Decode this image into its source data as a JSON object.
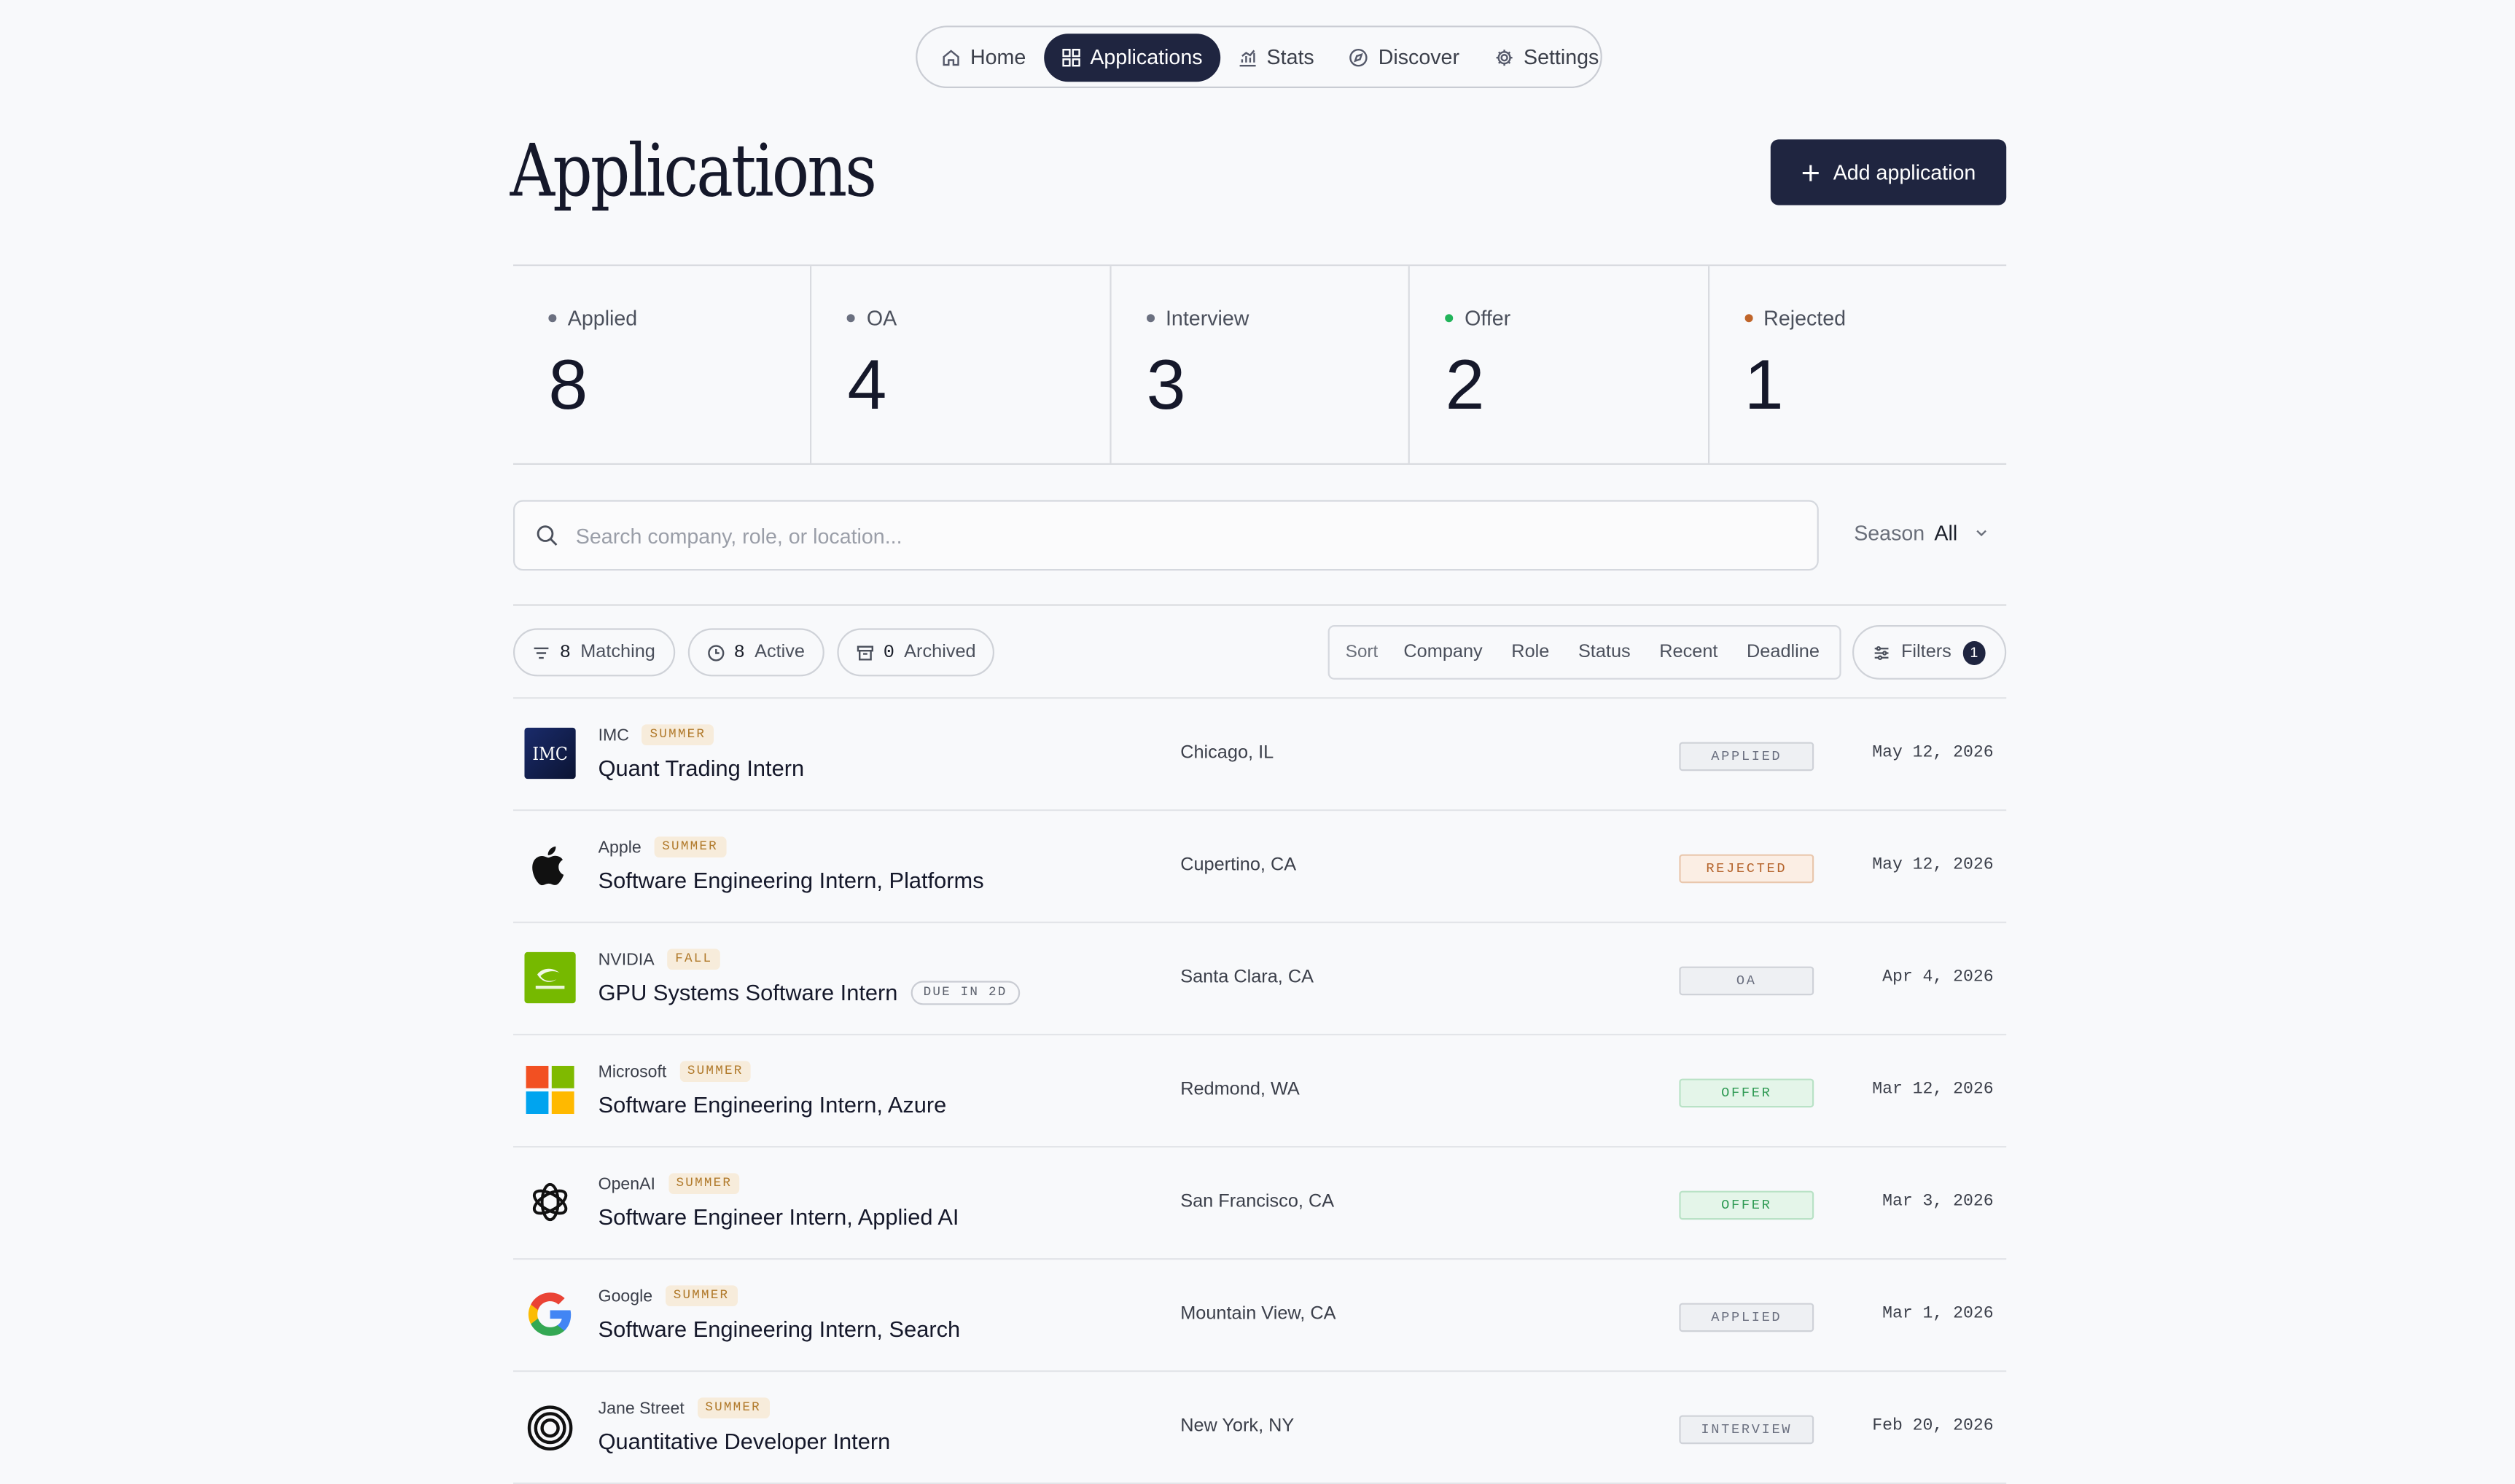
{
  "nav": {
    "items": [
      {
        "label": "Home",
        "icon": "home-icon"
      },
      {
        "label": "Applications",
        "icon": "grid-icon",
        "active": true
      },
      {
        "label": "Stats",
        "icon": "chart-icon"
      },
      {
        "label": "Discover",
        "icon": "compass-icon"
      },
      {
        "label": "Settings",
        "icon": "gear-icon"
      }
    ]
  },
  "header": {
    "title": "Applications",
    "add_label": "Add application"
  },
  "stats": [
    {
      "label": "Applied",
      "value": "8",
      "color": "#6b7080"
    },
    {
      "label": "OA",
      "value": "4",
      "color": "#6b7080"
    },
    {
      "label": "Interview",
      "value": "3",
      "color": "#6b7080"
    },
    {
      "label": "Offer",
      "value": "2",
      "color": "#22b45a"
    },
    {
      "label": "Rejected",
      "value": "1",
      "color": "#c0652a"
    }
  ],
  "search": {
    "placeholder": "Search company, role, or location...",
    "season_label": "Season",
    "season_value": "All"
  },
  "chips": {
    "matching_count": "8",
    "matching_label": "Matching",
    "active_count": "8",
    "active_label": "Active",
    "archived_count": "0",
    "archived_label": "Archived"
  },
  "sort": {
    "label": "Sort",
    "options": [
      "Company",
      "Role",
      "Status",
      "Recent",
      "Deadline"
    ]
  },
  "filters": {
    "label": "Filters",
    "count": "1"
  },
  "status_colors": {
    "APPLIED": {
      "fg": "#6b7080",
      "bg": "#eef0f3",
      "border": "#cfd2d8"
    },
    "REJECTED": {
      "fg": "#b5642c",
      "bg": "#fbeee4",
      "border": "#e9c7ad"
    },
    "OA": {
      "fg": "#6b7080",
      "bg": "#eef0f3",
      "border": "#cfd2d8"
    },
    "OFFER": {
      "fg": "#2f9a54",
      "bg": "#e4f5e9",
      "border": "#b9e2c6"
    },
    "INTERVIEW": {
      "fg": "#6b7080",
      "bg": "#eef0f3",
      "border": "#cfd2d8"
    }
  },
  "applications": [
    {
      "company": "IMC",
      "season": "SUMMER",
      "role": "Quant Trading Intern",
      "due": "",
      "location": "Chicago, IL",
      "status": "APPLIED",
      "date": "May 12, 2026",
      "logo": "imc-logo",
      "logo_text": "IMC"
    },
    {
      "company": "Apple",
      "season": "SUMMER",
      "role": "Software Engineering Intern, Platforms",
      "due": "",
      "location": "Cupertino, CA",
      "status": "REJECTED",
      "date": "May 12, 2026",
      "logo": "apple-logo"
    },
    {
      "company": "NVIDIA",
      "season": "FALL",
      "role": "GPU Systems Software Intern",
      "due": "DUE IN 2D",
      "location": "Santa Clara, CA",
      "status": "OA",
      "date": "Apr 4, 2026",
      "logo": "nvidia-logo"
    },
    {
      "company": "Microsoft",
      "season": "SUMMER",
      "role": "Software Engineering Intern, Azure",
      "due": "",
      "location": "Redmond, WA",
      "status": "OFFER",
      "date": "Mar 12, 2026",
      "logo": "microsoft-logo"
    },
    {
      "company": "OpenAI",
      "season": "SUMMER",
      "role": "Software Engineer Intern, Applied AI",
      "due": "",
      "location": "San Francisco, CA",
      "status": "OFFER",
      "date": "Mar 3, 2026",
      "logo": "openai-logo"
    },
    {
      "company": "Google",
      "season": "SUMMER",
      "role": "Software Engineering Intern, Search",
      "due": "",
      "location": "Mountain View, CA",
      "status": "APPLIED",
      "date": "Mar 1, 2026",
      "logo": "google-logo"
    },
    {
      "company": "Jane Street",
      "season": "SUMMER",
      "role": "Quantitative Developer Intern",
      "due": "",
      "location": "New York, NY",
      "status": "INTERVIEW",
      "date": "Feb 20, 2026",
      "logo": "janestreet-logo"
    }
  ]
}
